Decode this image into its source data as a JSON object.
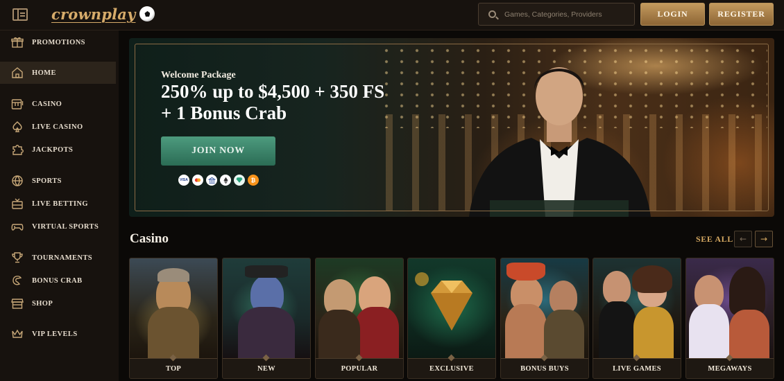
{
  "header": {
    "logo_text": "crownplay",
    "search_placeholder": "Games, Categories, Providers",
    "login_label": "LOGIN",
    "register_label": "REGISTER"
  },
  "sidebar": {
    "items": [
      {
        "label": "PROMOTIONS",
        "icon": "gift-icon"
      },
      {
        "label": "HOME",
        "icon": "home-icon",
        "active": true
      },
      {
        "label": "CASINO",
        "icon": "slot-machine-icon"
      },
      {
        "label": "LIVE CASINO",
        "icon": "spade-icon"
      },
      {
        "label": "JACKPOTS",
        "icon": "puzzle-icon"
      },
      {
        "label": "SPORTS",
        "icon": "basketball-icon"
      },
      {
        "label": "LIVE BETTING",
        "icon": "live-betting-icon"
      },
      {
        "label": "VIRTUAL SPORTS",
        "icon": "gamepad-icon"
      },
      {
        "label": "TOURNAMENTS",
        "icon": "trophy-icon"
      },
      {
        "label": "BONUS CRAB",
        "icon": "crab-claw-icon"
      },
      {
        "label": "SHOP",
        "icon": "shop-icon"
      },
      {
        "label": "VIP LEVELS",
        "icon": "crown-icon"
      }
    ]
  },
  "hero": {
    "subtitle": "Welcome Package",
    "title": "250% up to $4,500 + 350 FS + 1 Bonus Crab",
    "cta_label": "JOIN NOW",
    "payment_icons": [
      "visa-icon",
      "mastercard-icon",
      "bank-icon",
      "ethereum-icon",
      "tether-icon",
      "bitcoin-icon"
    ]
  },
  "casino": {
    "title": "Casino",
    "see_all_label": "SEE ALL",
    "categories": [
      {
        "label": "TOP"
      },
      {
        "label": "NEW"
      },
      {
        "label": "POPULAR"
      },
      {
        "label": "EXCLUSIVE"
      },
      {
        "label": "BONUS BUYS"
      },
      {
        "label": "LIVE GAMES"
      },
      {
        "label": "MEGAWAYS"
      }
    ]
  },
  "colors": {
    "background": "#0b0907",
    "sidebar": "#17120e",
    "gold_accent": "#d6a962",
    "green_cta": "#3a8a6c"
  }
}
